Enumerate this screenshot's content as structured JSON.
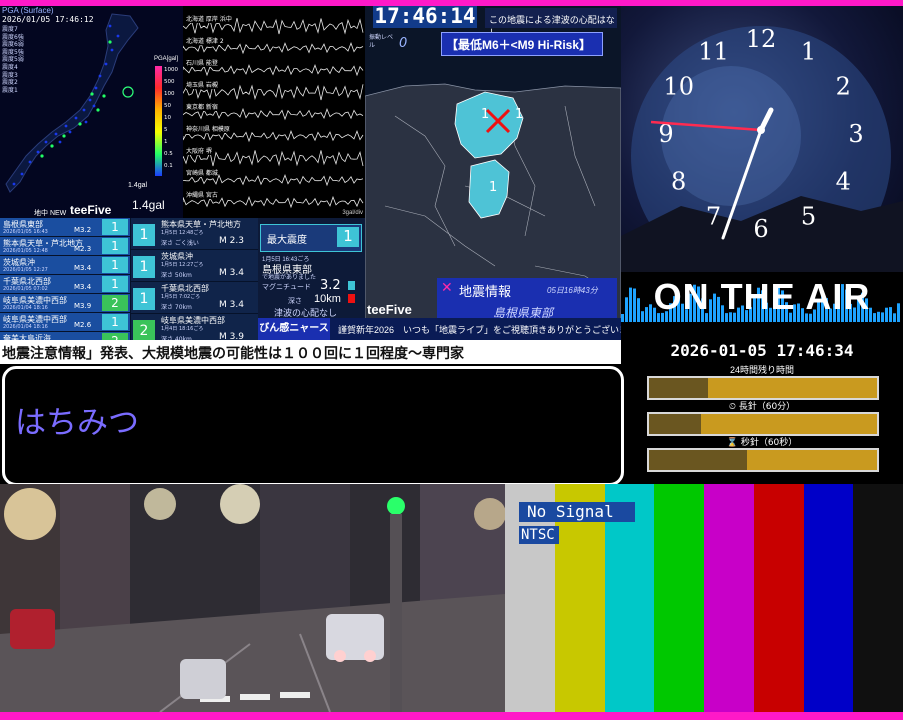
{
  "map": {
    "pga_label": "PGA (Surface)",
    "timestamp": "2026/01/05 17:46:12",
    "gal_value": "1.4gal",
    "gal_small": "1.4gal",
    "unit_label": "PGA[gal]",
    "scale_ticks": [
      "1000",
      "500",
      "100",
      "50",
      "10",
      "5",
      "1",
      "0.5",
      "0.1"
    ],
    "status_items": [
      "震度7",
      "震度6強",
      "震度6弱",
      "震度5強",
      "震度5弱",
      "震度4",
      "震度3",
      "震度2",
      "震度1"
    ],
    "brand": "teeFive",
    "new_label": "地中 NEW"
  },
  "waveform": {
    "stations": [
      "北海道 厚岸 浜中",
      "北海道 標津 2",
      "石川県 能登",
      "埼玉県 岩槻",
      "東京都 新宿",
      "神奈川県 相模原",
      "大阪府 堺",
      "宮崎県 都城",
      "沖縄県 宮古"
    ],
    "scale_label": "3gal/div"
  },
  "quake": {
    "clock": "17:46:14",
    "banner_top": "この地震による津波の心配はなし",
    "level_label": "振動レベル",
    "level_value": "0",
    "risk_banner": "【最低M6＋<M9 Hi-Risk】",
    "info_title": "地震情報",
    "info_time": "05日16時43分",
    "region": "島根県東部",
    "brand": "teeFive",
    "intensity_a": "1",
    "intensity_b": "1",
    "intensity_c": "1"
  },
  "list": {
    "rows": [
      {
        "place": "島根県東部",
        "date": "2026/01/05 16:43",
        "mag": "M3.2",
        "shindo": "1"
      },
      {
        "place": "熊本県天草・芦北地方",
        "date": "2026/01/05 12:48",
        "mag": "M2.3",
        "shindo": "1"
      },
      {
        "place": "茨城県沖",
        "date": "2026/01/05 12:27",
        "mag": "M3.4",
        "shindo": "1"
      },
      {
        "place": "千葉県北西部",
        "date": "2026/01/05 07:02",
        "mag": "M3.4",
        "shindo": "1"
      },
      {
        "place": "岐阜県美濃中西部",
        "date": "2026/01/04 18:16",
        "mag": "M3.9",
        "shindo": "2"
      },
      {
        "place": "岐阜県美濃中西部",
        "date": "2026/01/04 18:16",
        "mag": "M2.6",
        "shindo": "1"
      },
      {
        "place": "奄美大島近海",
        "date": "2026/01/02 08:43",
        "mag": "M3.7",
        "shindo": "2"
      }
    ],
    "cards": [
      {
        "place": "熊本県天草・芦北地方",
        "date": "1月5日 12:48ごろ",
        "depth": "深さ ごく浅い",
        "mag": "M 2.3",
        "shindo": "1"
      },
      {
        "place": "茨城県沖",
        "date": "1月5日 12:27ごろ",
        "depth": "深さ 50km",
        "mag": "M 3.4",
        "shindo": "1"
      },
      {
        "place": "千葉県北西部",
        "date": "1月5日 7:02ごろ",
        "depth": "深さ 70km",
        "mag": "M 3.4",
        "shindo": "1"
      },
      {
        "place": "岐阜県美濃中西部",
        "date": "1月4日 18:16ごろ",
        "depth": "深さ 40km",
        "mag": "M 3.9",
        "shindo": "2"
      }
    ]
  },
  "info": {
    "max_label": "最大震度",
    "max_value": "1",
    "date": "1月5日 16:43ごろ",
    "place": "島根県東部",
    "tsunami_short": "で地震がありました",
    "mag_label": "マグニチュード",
    "mag_value": "3.2",
    "depth_label": "深さ",
    "depth_value": "10km",
    "tsunami": "津波の心配なし"
  },
  "ticker": {
    "tag": "びん感ニャース",
    "line1": "謹賀新年2026　いつも「地震ライブ」をご視聴頂きありがとうございます!",
    "line2": "地震注意情報」発表、大規模地震の可能性は１００回に１回程度～専門家"
  },
  "name_box": {
    "text": "はちみつ"
  },
  "clock": {
    "numerals": [
      "12",
      "1",
      "2",
      "3",
      "4",
      "5",
      "6",
      "7",
      "8",
      "9",
      "10",
      "11"
    ]
  },
  "air": {
    "title": "ON THE AIR",
    "datetime": "2026-01-05 17:46:34",
    "bar1_label": "24時間残り時間",
    "bar2_label": "長針（60分）",
    "bar3_label": "秒針（60秒）",
    "bar1_progress": 0.26,
    "bar2_progress": 0.23,
    "bar3_progress": 0.43
  },
  "bars": {
    "no_signal": "No Signal",
    "standard": "NTSC",
    "colors": [
      "#c8c8c8",
      "#c8c800",
      "#00c8c8",
      "#00c800",
      "#c800c8",
      "#c80000",
      "#0000c8",
      "#101010"
    ]
  },
  "colors": {
    "accent": "#ff19c8",
    "info_blue": "#1a2fb0",
    "cyan": "#3ec4d6"
  }
}
